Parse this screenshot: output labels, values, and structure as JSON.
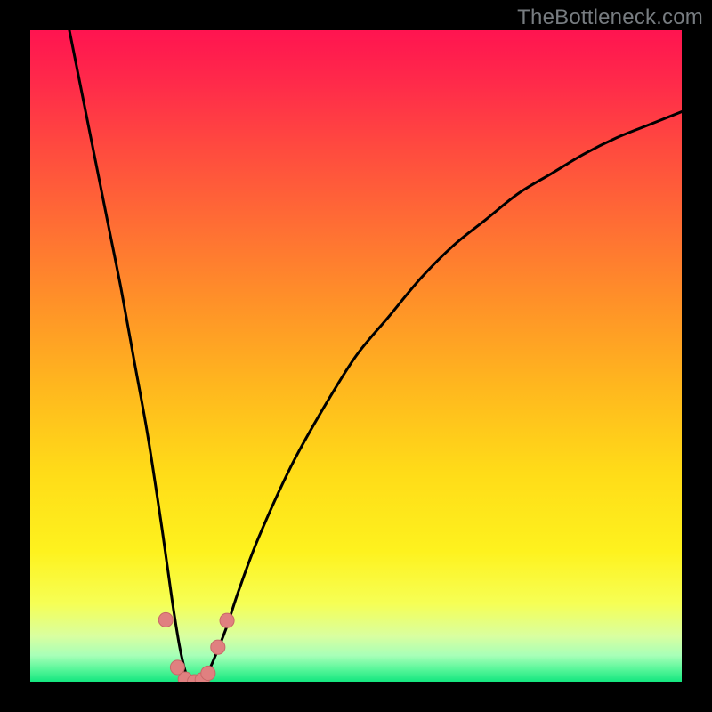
{
  "watermark": "TheBottleneck.com",
  "colors": {
    "frame": "#000000",
    "curve": "#000000",
    "marker_fill": "#e08080",
    "marker_stroke": "#c86868"
  },
  "chart_data": {
    "type": "line",
    "title": "",
    "xlabel": "",
    "ylabel": "",
    "xlim": [
      0,
      100
    ],
    "ylim": [
      0,
      100
    ],
    "grid": false,
    "series": [
      {
        "name": "bottleneck-curve",
        "x": [
          6,
          8,
          10,
          12,
          14,
          16,
          18,
          20,
          21,
          22,
          23,
          24,
          25,
          26,
          27,
          28,
          30,
          32,
          35,
          40,
          45,
          50,
          55,
          60,
          65,
          70,
          75,
          80,
          85,
          90,
          95,
          100
        ],
        "values": [
          100,
          90,
          80,
          70,
          60,
          49,
          38,
          25,
          18,
          11,
          5,
          1,
          0,
          0,
          1,
          3,
          8,
          14,
          22,
          33,
          42,
          50,
          56,
          62,
          67,
          71,
          75,
          78,
          81,
          83.5,
          85.5,
          87.5
        ]
      }
    ],
    "markers": [
      {
        "x": 20.8,
        "y": 9.5,
        "r": 1.1
      },
      {
        "x": 22.6,
        "y": 2.2,
        "r": 1.1
      },
      {
        "x": 23.8,
        "y": 0.4,
        "r": 1.1
      },
      {
        "x": 25.2,
        "y": 0.0,
        "r": 1.1
      },
      {
        "x": 26.4,
        "y": 0.3,
        "r": 1.1
      },
      {
        "x": 27.3,
        "y": 1.3,
        "r": 1.1
      },
      {
        "x": 28.8,
        "y": 5.3,
        "r": 1.1
      },
      {
        "x": 30.2,
        "y": 9.4,
        "r": 1.1
      }
    ]
  }
}
